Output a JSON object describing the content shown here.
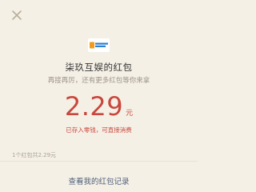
{
  "header": {
    "close_icon": "close-icon"
  },
  "sender": {
    "logo_icon": "app-logo",
    "name": "柒玖互娱的红包",
    "greeting": "再接再厉，还有更多红包等你来拿"
  },
  "red_packet": {
    "amount": "2.29",
    "unit": "元",
    "note": "已存入零钱，可直接消费"
  },
  "summary": {
    "text": "1个红包共2.29元"
  },
  "footer": {
    "records_link": "查看我的红包记录"
  },
  "colors": {
    "background": "#f5f0e6",
    "accent_red": "#c9463c",
    "link_blue": "#4e5f7a"
  }
}
